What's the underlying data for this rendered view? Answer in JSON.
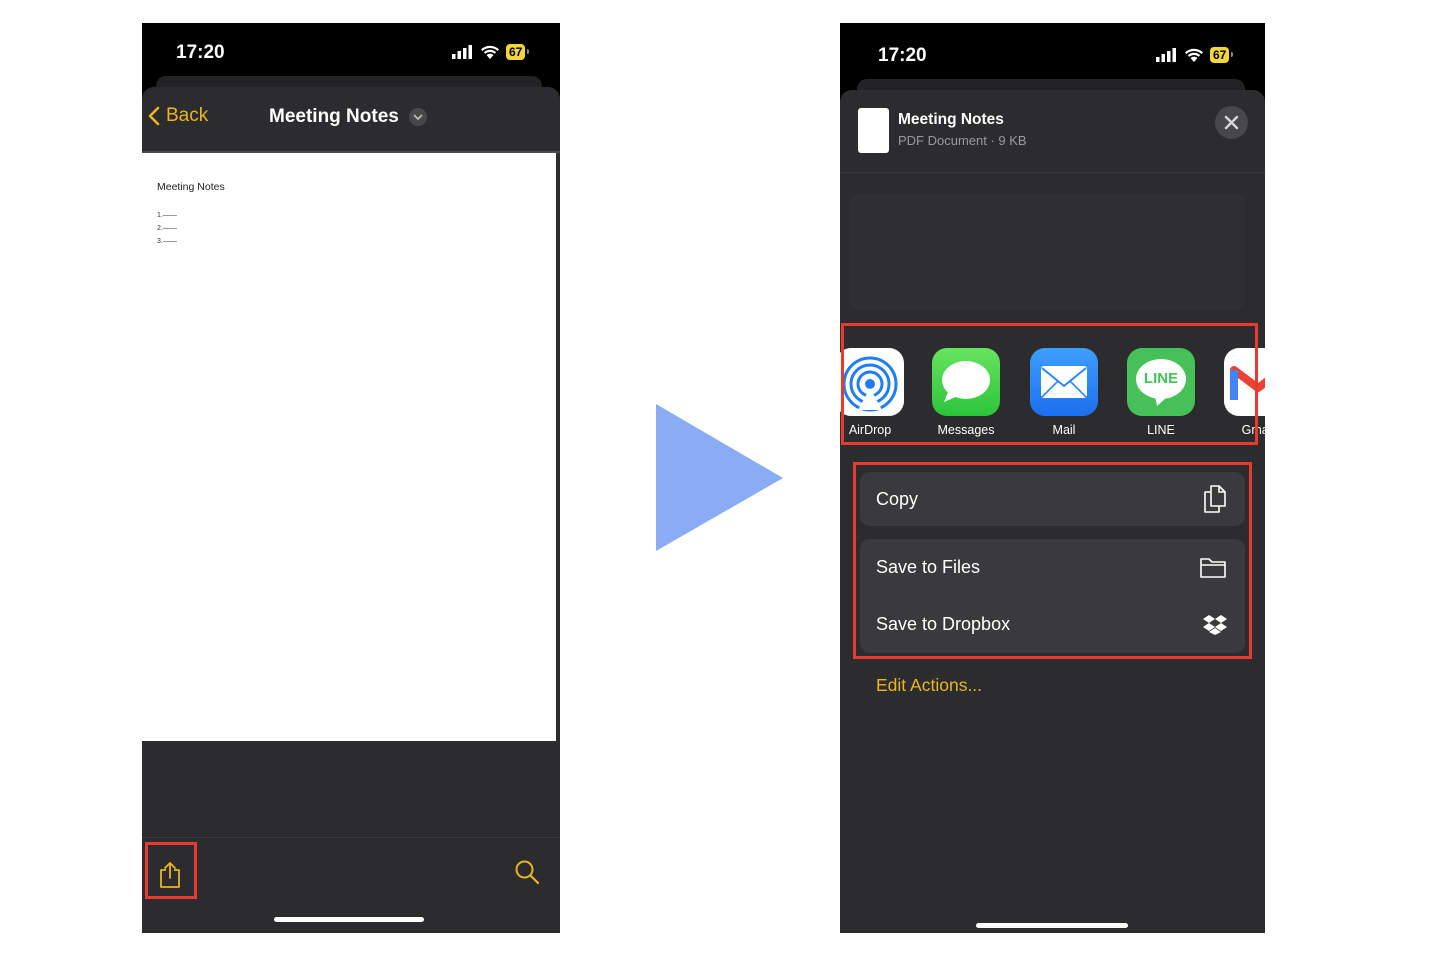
{
  "left_screen": {
    "status": {
      "time": "17:20",
      "battery": "67"
    },
    "nav": {
      "back_label": "Back",
      "title": "Meeting Notes"
    },
    "document": {
      "heading": "Meeting Notes",
      "lines": [
        "1.——",
        "2.——",
        "3.——"
      ]
    },
    "toolbar": {
      "share_icon": "share-icon",
      "search_icon": "search-icon"
    }
  },
  "transition_arrow": {
    "color": "#8aacf5"
  },
  "right_screen": {
    "status": {
      "time": "17:20",
      "battery": "67"
    },
    "share_header": {
      "file_name": "Meeting Notes",
      "file_info": "PDF Document · 9 KB"
    },
    "apps": [
      {
        "label": "AirDrop",
        "icon": "airdrop-icon"
      },
      {
        "label": "Messages",
        "icon": "messages-icon"
      },
      {
        "label": "Mail",
        "icon": "mail-icon"
      },
      {
        "label": "LINE",
        "icon": "line-icon",
        "icon_text": "LINE"
      },
      {
        "label": "Gmail",
        "icon": "gmail-icon"
      }
    ],
    "actions": [
      {
        "label": "Copy",
        "icon": "copy-icon"
      },
      {
        "label": "Save to Files",
        "icon": "folder-icon"
      },
      {
        "label": "Save to Dropbox",
        "icon": "dropbox-icon"
      }
    ],
    "edit_actions_label": "Edit Actions..."
  },
  "colors": {
    "accent": "#e9b425",
    "highlight_box": "#e63b2e",
    "sheet_bg": "#2c2c2e",
    "row_bg": "#3a3a3c"
  }
}
